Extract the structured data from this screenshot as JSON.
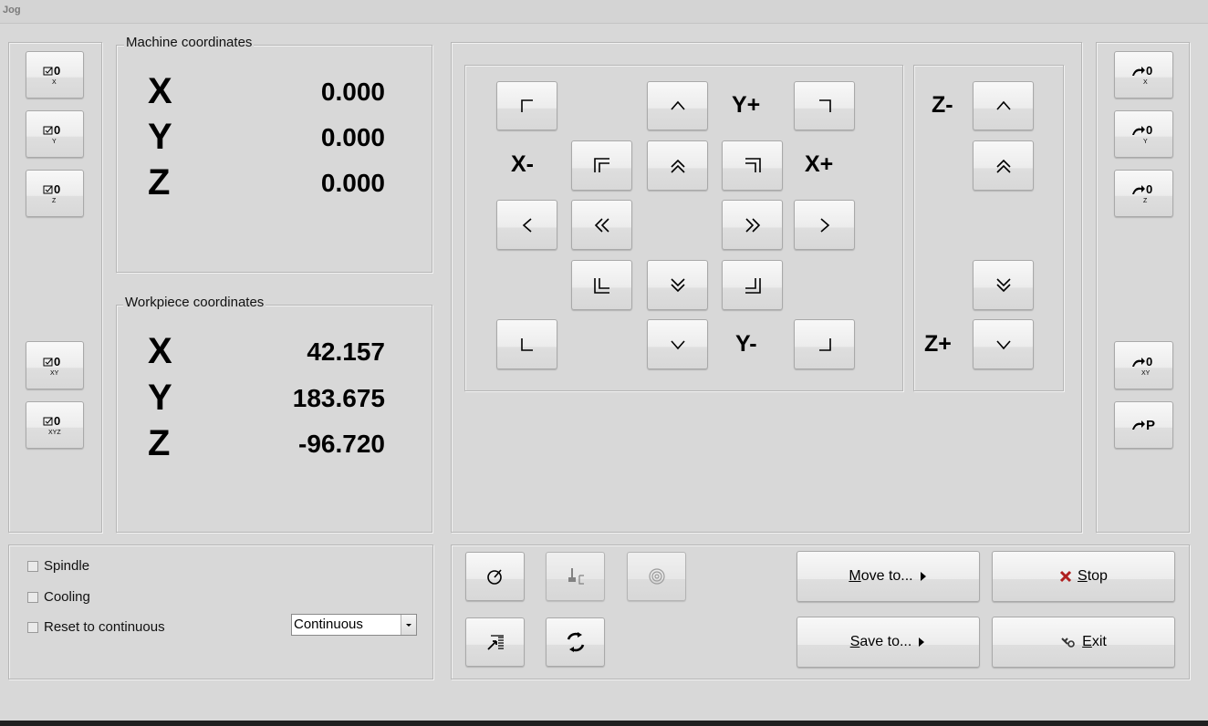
{
  "window": {
    "title": "Jog"
  },
  "machine": {
    "legend": "Machine coordinates",
    "coords": [
      {
        "axis": "X",
        "value": "0.000"
      },
      {
        "axis": "Y",
        "value": "0.000"
      },
      {
        "axis": "Z",
        "value": "0.000"
      }
    ]
  },
  "workpiece": {
    "legend": "Workpiece coordinates",
    "coords": [
      {
        "axis": "X",
        "value": "42.157"
      },
      {
        "axis": "Y",
        "value": "183.675"
      },
      {
        "axis": "Z",
        "value": "-96.720"
      }
    ]
  },
  "left_zero_buttons": [
    {
      "label": "0",
      "sub": "X"
    },
    {
      "label": "0",
      "sub": "Y"
    },
    {
      "label": "0",
      "sub": "Z"
    },
    {
      "label": "0",
      "sub": "XY"
    },
    {
      "label": "0",
      "sub": "XYZ"
    }
  ],
  "right_goto_buttons": [
    {
      "label": "0",
      "sub": "X"
    },
    {
      "label": "0",
      "sub": "Y"
    },
    {
      "label": "0",
      "sub": "Z"
    },
    {
      "label": "0",
      "sub": "XY"
    },
    {
      "label": "P",
      "sub": ""
    }
  ],
  "jog_labels": {
    "y_plus": "Y+",
    "y_minus": "Y-",
    "x_minus": "X-",
    "x_plus": "X+",
    "z_minus": "Z-",
    "z_plus": "Z+"
  },
  "options": {
    "spindle": "Spindle",
    "cooling": "Cooling",
    "reset": "Reset to continuous",
    "mode_value": "Continuous"
  },
  "actions": {
    "move_to": {
      "u": "M",
      "rest": "ove to..."
    },
    "save_to": {
      "u": "S",
      "rest": "ave to..."
    },
    "stop": {
      "u": "S",
      "rest": "top"
    },
    "exit": {
      "u": "E",
      "rest": "xit"
    }
  },
  "colors": {
    "stop_icon": "#b02020",
    "background": "#d8d8d8"
  }
}
